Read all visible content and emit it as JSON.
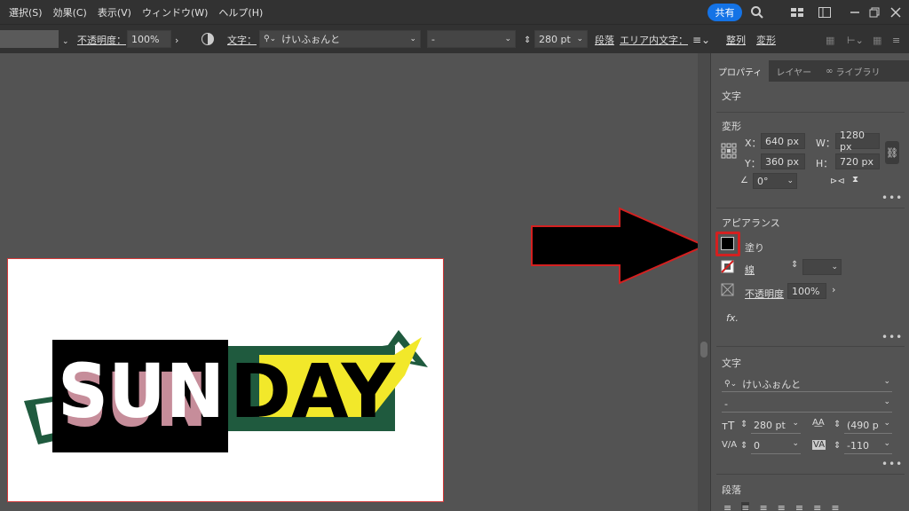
{
  "menubar": {
    "items": [
      "選択(S)",
      "効果(C)",
      "表示(V)",
      "ウィンドウ(W)",
      "ヘルプ(H)"
    ],
    "share_label": "共有"
  },
  "control_bar": {
    "opacity_label": "不透明度：",
    "opacity_value": "100%",
    "type_label": "文字：",
    "font_family": "けいふぉんと",
    "font_style": "-",
    "font_size": "280 pt",
    "paragraph_label": "段落",
    "area_type_label": "エリア内文字：",
    "align_label": "整列",
    "transform_label": "変形"
  },
  "artboard": {
    "word_left": "SUN",
    "word_right": "DAY"
  },
  "panel": {
    "tabs": [
      "プロパティ",
      "レイヤー",
      "ライブラリ"
    ],
    "section_type": "文字",
    "transform": {
      "title": "変形",
      "x_label": "X：",
      "x_value": "640 px",
      "y_label": "Y：",
      "y_value": "360 px",
      "w_label": "W：",
      "w_value": "1280 px",
      "h_label": "H：",
      "h_value": "720 px",
      "rotate_value": "0°"
    },
    "appearance": {
      "title": "アピアランス",
      "fill_label": "塗り",
      "stroke_label": "線",
      "opacity_label": "不透明度",
      "opacity_value": "100%",
      "fx_label": "fx."
    },
    "character": {
      "title": "文字",
      "font_family": "けいふぉんと",
      "font_style": "-",
      "font_size": "280 pt",
      "leading": "(490 p",
      "kerning": "0",
      "tracking": "-110"
    },
    "paragraph_title": "段落"
  },
  "colors": {
    "accent": "#1473e6",
    "highlight_red": "#d42020",
    "sun_text": "#ffffff",
    "day_text": "#000000",
    "yellow": "#f2e82a",
    "green": "#1f5a3e",
    "pink": "#e9a6b6"
  }
}
